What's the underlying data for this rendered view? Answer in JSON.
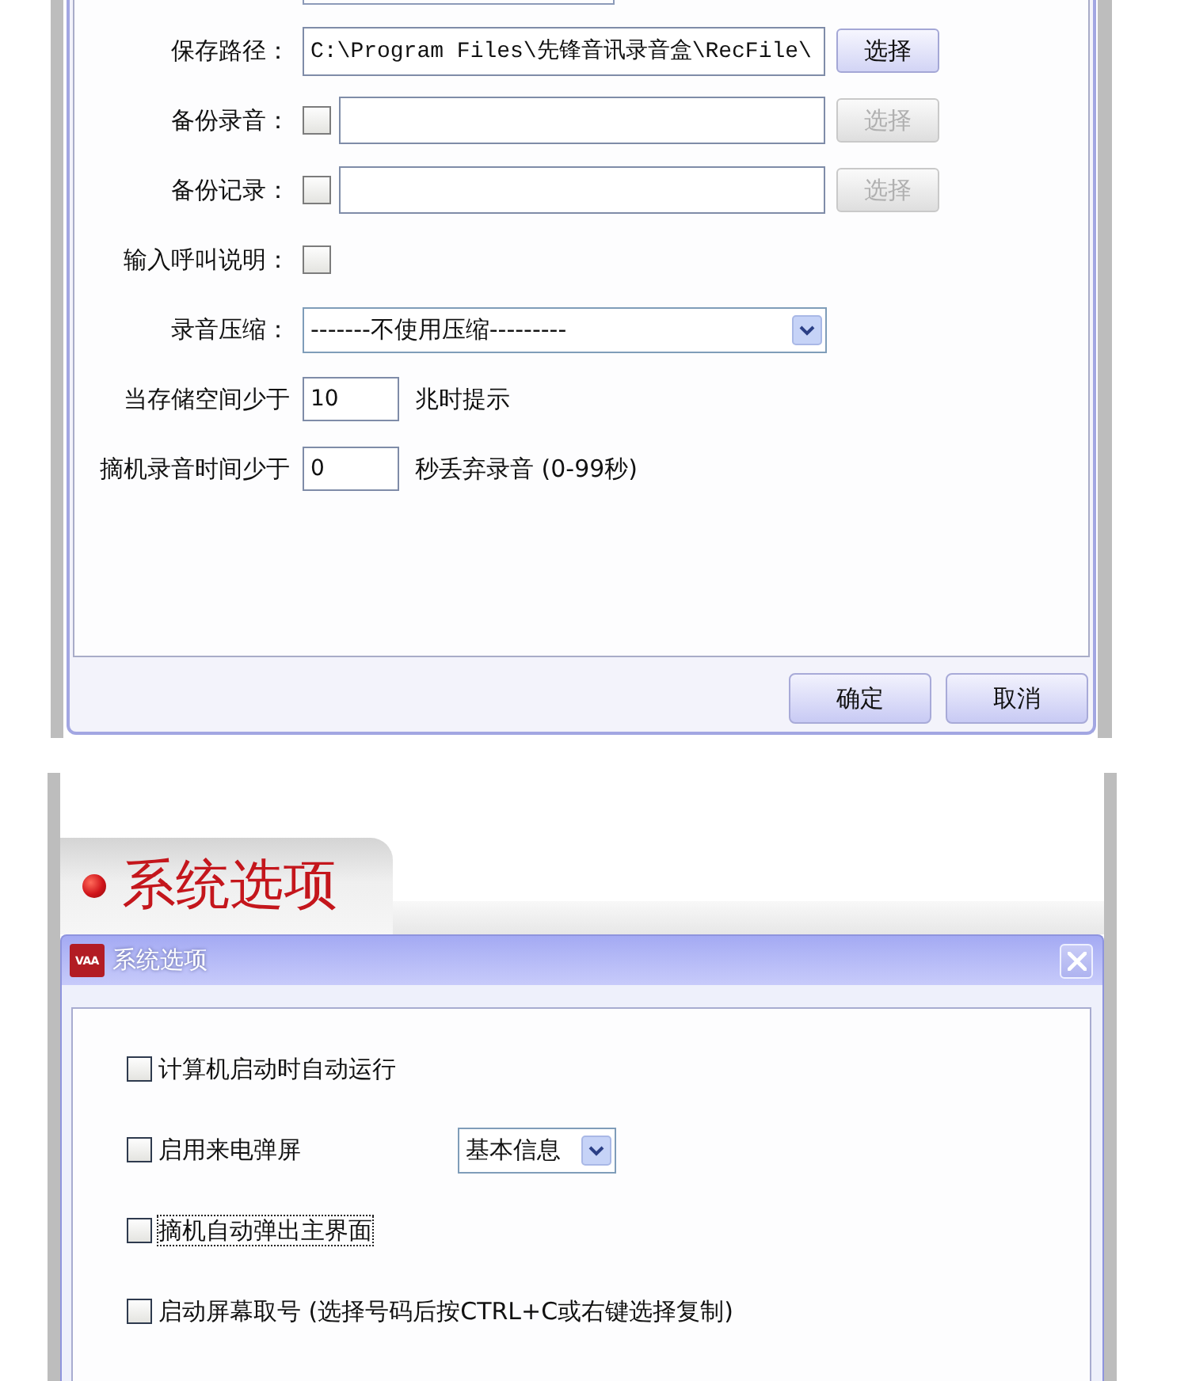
{
  "storage_dialog": {
    "rows": [
      {
        "kind": "path",
        "label": "保存路径：",
        "value": "C:\\Program Files\\先锋音讯录音盒\\RecFile\\",
        "button": {
          "label": "选择",
          "disabled": false
        }
      },
      {
        "kind": "backup",
        "label": "备份录音：",
        "checked": false,
        "button": {
          "label": "选择",
          "disabled": true
        }
      },
      {
        "kind": "backup",
        "label": "备份记录：",
        "checked": false,
        "button": {
          "label": "选择",
          "disabled": true
        }
      },
      {
        "kind": "checkbox",
        "label": "输入呼叫说明：",
        "checked": false
      },
      {
        "kind": "select",
        "label": "录音压缩：",
        "value": "-------不使用压缩---------"
      },
      {
        "kind": "number",
        "label": "当存储空间少于",
        "value": "10",
        "suffix": "兆时提示"
      },
      {
        "kind": "number",
        "label": "摘机录音时间少于",
        "value": "0",
        "suffix": "秒丢弃录音 (0-99秒)"
      }
    ],
    "buttons": [
      {
        "label": "确定"
      },
      {
        "label": "取消"
      }
    ]
  },
  "section_header": {
    "title": "系统选项"
  },
  "options_dialog": {
    "logo_text": "VAA",
    "title": "系统选项",
    "options": [
      {
        "kind": "checkbox",
        "label": "计算机启动时自动运行",
        "checked": false,
        "focused": false
      },
      {
        "kind": "checkbox_select",
        "label": "启用来电弹屏",
        "checked": false,
        "focused": false,
        "select_value": "基本信息"
      },
      {
        "kind": "checkbox",
        "label": "摘机自动弹出主界面",
        "checked": false,
        "focused": true
      },
      {
        "kind": "checkbox",
        "label": "启动屏幕取号 (选择号码后按CTRL+C或右键选择复制)",
        "checked": false,
        "focused": false
      }
    ]
  }
}
